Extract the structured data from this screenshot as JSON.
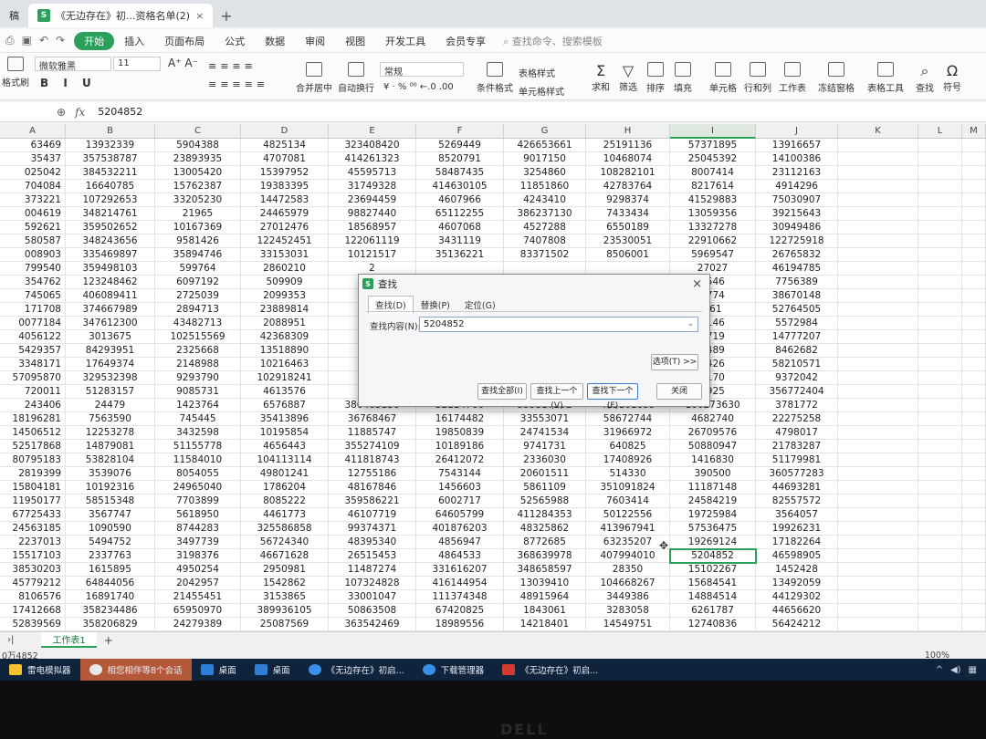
{
  "tabs": {
    "left_fragment": "稿",
    "active_title": "《无边存在》初...资格名单(2)",
    "add": "+"
  },
  "menu": {
    "items": [
      "开始",
      "插入",
      "页面布局",
      "公式",
      "数据",
      "审阅",
      "视图",
      "开发工具",
      "会员专享"
    ],
    "search": "查找命令、搜索模板"
  },
  "ribbon": {
    "format_painter": "格式刷",
    "font_name": "微软雅黑",
    "font_size": "11",
    "number_format": "常规",
    "merge": "合并居中",
    "wrap": "自动换行",
    "conditional_format": "条件格式",
    "table_style": "表格样式",
    "cell_style": "单元格样式",
    "sum": "求和",
    "filter": "筛选",
    "sort": "排序",
    "fill": "填充",
    "cells": "单元格",
    "rows_cols": "行和列",
    "worksheet": "工作表",
    "freeze": "冻结窗格",
    "table_tools": "表格工具",
    "find": "查找",
    "symbol": "符号"
  },
  "formula_bar": {
    "fx": "fx",
    "content": "5204852"
  },
  "columns": [
    "A",
    "B",
    "C",
    "D",
    "E",
    "F",
    "G",
    "H",
    "I",
    "J",
    "K",
    "L",
    "M"
  ],
  "rows": [
    [
      "63469",
      "13932339",
      "5904388",
      "4825134",
      "323408420",
      "5269449",
      "426653661",
      "25191136",
      "57371895",
      "13916657"
    ],
    [
      "35437",
      "357538787",
      "23893935",
      "4707081",
      "414261323",
      "8520791",
      "9017150",
      "10468074",
      "25045392",
      "14100386"
    ],
    [
      "025042",
      "384532211",
      "13005420",
      "15397952",
      "45595713",
      "58487435",
      "3254860",
      "108282101",
      "8007414",
      "23112163"
    ],
    [
      "704084",
      "16640785",
      "15762387",
      "19383395",
      "31749328",
      "414630105",
      "11851860",
      "42783764",
      "8217614",
      "4914296"
    ],
    [
      "373221",
      "107292653",
      "33205230",
      "14472583",
      "23694459",
      "4607966",
      "4243410",
      "9298374",
      "41529883",
      "75030907"
    ],
    [
      "004619",
      "348214761",
      "21965",
      "24465979",
      "98827440",
      "65112255",
      "386237130",
      "7433434",
      "13059356",
      "39215643"
    ],
    [
      "592621",
      "359502652",
      "10167369",
      "27012476",
      "18568957",
      "4607068",
      "4527288",
      "6550189",
      "13327278",
      "30949486"
    ],
    [
      "580587",
      "348243656",
      "9581426",
      "122452451",
      "122061119",
      "3431119",
      "7407808",
      "23530051",
      "22910662",
      "122725918"
    ],
    [
      "008903",
      "335469897",
      "35894746",
      "33153031",
      "10121517",
      "35136221",
      "83371502",
      "8506001",
      "5969547",
      "26765832"
    ],
    [
      "799540",
      "359498103",
      "599764",
      "2860210",
      "2",
      "",
      "",
      "",
      "27027",
      "46194785"
    ],
    [
      "354762",
      "123248462",
      "6097192",
      "509909",
      "10",
      "",
      "",
      "",
      "8546",
      "7756389"
    ],
    [
      "745065",
      "406089411",
      "2725039",
      "2099353",
      "1",
      "",
      "",
      "",
      "8774",
      "38670148"
    ],
    [
      "171708",
      "374667989",
      "2894713",
      "23889814",
      "40",
      "",
      "",
      "",
      "961",
      "52764505"
    ],
    [
      "0077184",
      "347612300",
      "43482713",
      "2088951",
      "40",
      "",
      "",
      "",
      "3146",
      "5572984"
    ],
    [
      "4056122",
      "3013675",
      "102515569",
      "42368309",
      "7",
      "",
      "",
      "",
      "3719",
      "14777207"
    ],
    [
      "5429357",
      "84293951",
      "2325668",
      "13518890",
      "12",
      "",
      "",
      "",
      "2489",
      "8462682"
    ],
    [
      "3348171",
      "17649374",
      "2148988",
      "10216463",
      "30",
      "",
      "",
      "",
      "5426",
      "58210571"
    ],
    [
      "57095870",
      "329532398",
      "9293790",
      "102918241",
      "33",
      "",
      "",
      "",
      "5170",
      "9372042"
    ],
    [
      "720011",
      "51283157",
      "9085731",
      "4613576",
      "38",
      "",
      "",
      "",
      "2925",
      "356772404"
    ],
    [
      "243406",
      "24479",
      "1423764",
      "6576887",
      "386463136",
      "32114706",
      "359317292",
      "415161659",
      "100273630",
      "3781772"
    ],
    [
      "18196281",
      "7563590",
      "745445",
      "35413896",
      "36768467",
      "16174482",
      "33553071",
      "58672744",
      "4682740",
      "22275258"
    ],
    [
      "14506512",
      "12253278",
      "3432598",
      "10195854",
      "11885747",
      "19850839",
      "24741534",
      "31966972",
      "26709576",
      "4798017"
    ],
    [
      "52517868",
      "14879081",
      "51155778",
      "4656443",
      "355274109",
      "10189186",
      "9741731",
      "640825",
      "50880947",
      "21783287"
    ],
    [
      "80795183",
      "53828104",
      "11584010",
      "104113114",
      "411818743",
      "26412072",
      "2336030",
      "17408926",
      "1416830",
      "51179981"
    ],
    [
      "2819399",
      "3539076",
      "8054055",
      "49801241",
      "12755186",
      "7543144",
      "20601511",
      "514330",
      "390500",
      "360577283"
    ],
    [
      "15804181",
      "10192316",
      "24965040",
      "1786204",
      "48167846",
      "1456603",
      "5861109",
      "351091824",
      "11187148",
      "44693281"
    ],
    [
      "11950177",
      "58515348",
      "7703899",
      "8085222",
      "359586221",
      "6002717",
      "52565988",
      "7603414",
      "24584219",
      "82557572"
    ],
    [
      "67725433",
      "3567747",
      "5618950",
      "4461773",
      "46107719",
      "64605799",
      "411284353",
      "50122556",
      "19725984",
      "3564057"
    ],
    [
      "24563185",
      "1090590",
      "8744283",
      "325586858",
      "99374371",
      "401876203",
      "48325862",
      "413967941",
      "57536475",
      "19926231"
    ],
    [
      "2237013",
      "5494752",
      "3497739",
      "56724340",
      "48395340",
      "4856947",
      "8772685",
      "63235207",
      "19269124",
      "17182264"
    ],
    [
      "15517103",
      "2337763",
      "3198376",
      "46671628",
      "26515453",
      "4864533",
      "368639978",
      "407994010",
      "5204852",
      "46598905"
    ],
    [
      "38530203",
      "1615895",
      "4950254",
      "2950981",
      "11487274",
      "331616207",
      "348658597",
      "28350",
      "15102267",
      "1452428"
    ],
    [
      "45779212",
      "64844056",
      "2042957",
      "1542862",
      "107324828",
      "416144954",
      "13039410",
      "104668267",
      "15684541",
      "13492059"
    ],
    [
      "8106576",
      "16891740",
      "21455451",
      "3153865",
      "33001047",
      "111374348",
      "48915964",
      "3449386",
      "14884514",
      "44129302"
    ],
    [
      "17412668",
      "358234486",
      "65950970",
      "389936105",
      "50863508",
      "67420825",
      "1843061",
      "3283058",
      "6261787",
      "44656620"
    ],
    [
      "52839569",
      "358206829",
      "24279389",
      "25087569",
      "363542469",
      "18989556",
      "14218401",
      "14549751",
      "12740836",
      "56424212"
    ]
  ],
  "selected_cell_value": "5204852",
  "sheet_tab": "工作表1",
  "status": {
    "left": "0万4852",
    "zoom": "100%"
  },
  "dialog": {
    "title": "查找",
    "close": "×",
    "tabs": [
      "查找(D)",
      "替换(P)",
      "定位(G)"
    ],
    "label": "查找内容(N):",
    "value": "5204852",
    "options": "选项(T) >>",
    "find_all": "查找全部(I)",
    "find_prev": "查找上一个(V)",
    "find_next": "查找下一个(F)",
    "close_button": "关闭"
  },
  "taskbar": {
    "items": [
      "雷电模拟器",
      "相您相伴等8个会话",
      "桌面",
      "桌面",
      "《无边存在》初启...",
      "下载管理器",
      "《无边存在》初启..."
    ]
  },
  "colors": {
    "accent": "#2aa05a",
    "taskbar": "#10233d"
  }
}
